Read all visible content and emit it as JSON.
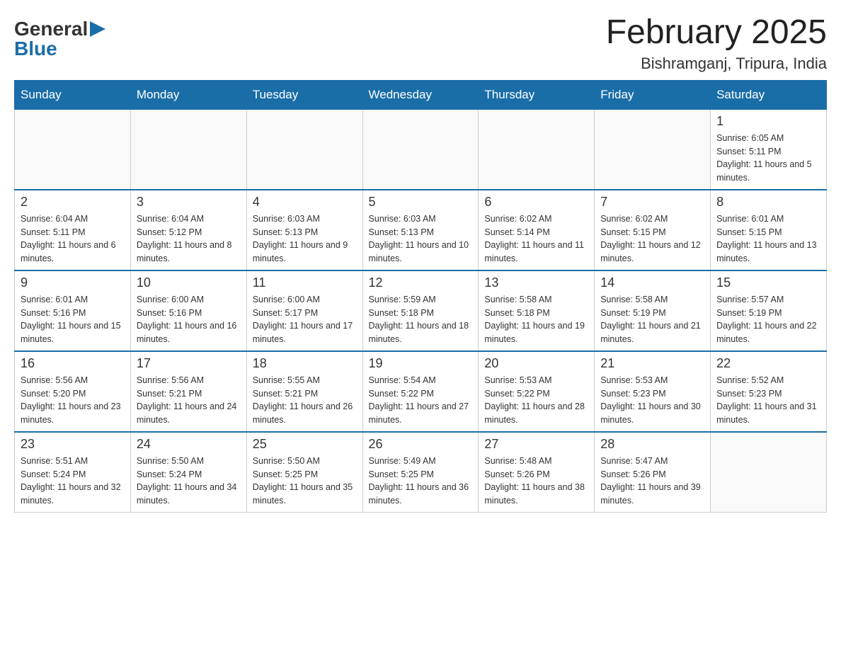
{
  "header": {
    "logo": {
      "general": "General",
      "arrow": "▶",
      "blue": "Blue"
    },
    "title": "February 2025",
    "location": "Bishramganj, Tripura, India"
  },
  "weekdays": [
    "Sunday",
    "Monday",
    "Tuesday",
    "Wednesday",
    "Thursday",
    "Friday",
    "Saturday"
  ],
  "weeks": [
    [
      {
        "day": "",
        "info": ""
      },
      {
        "day": "",
        "info": ""
      },
      {
        "day": "",
        "info": ""
      },
      {
        "day": "",
        "info": ""
      },
      {
        "day": "",
        "info": ""
      },
      {
        "day": "",
        "info": ""
      },
      {
        "day": "1",
        "info": "Sunrise: 6:05 AM\nSunset: 5:11 PM\nDaylight: 11 hours and 5 minutes."
      }
    ],
    [
      {
        "day": "2",
        "info": "Sunrise: 6:04 AM\nSunset: 5:11 PM\nDaylight: 11 hours and 6 minutes."
      },
      {
        "day": "3",
        "info": "Sunrise: 6:04 AM\nSunset: 5:12 PM\nDaylight: 11 hours and 8 minutes."
      },
      {
        "day": "4",
        "info": "Sunrise: 6:03 AM\nSunset: 5:13 PM\nDaylight: 11 hours and 9 minutes."
      },
      {
        "day": "5",
        "info": "Sunrise: 6:03 AM\nSunset: 5:13 PM\nDaylight: 11 hours and 10 minutes."
      },
      {
        "day": "6",
        "info": "Sunrise: 6:02 AM\nSunset: 5:14 PM\nDaylight: 11 hours and 11 minutes."
      },
      {
        "day": "7",
        "info": "Sunrise: 6:02 AM\nSunset: 5:15 PM\nDaylight: 11 hours and 12 minutes."
      },
      {
        "day": "8",
        "info": "Sunrise: 6:01 AM\nSunset: 5:15 PM\nDaylight: 11 hours and 13 minutes."
      }
    ],
    [
      {
        "day": "9",
        "info": "Sunrise: 6:01 AM\nSunset: 5:16 PM\nDaylight: 11 hours and 15 minutes."
      },
      {
        "day": "10",
        "info": "Sunrise: 6:00 AM\nSunset: 5:16 PM\nDaylight: 11 hours and 16 minutes."
      },
      {
        "day": "11",
        "info": "Sunrise: 6:00 AM\nSunset: 5:17 PM\nDaylight: 11 hours and 17 minutes."
      },
      {
        "day": "12",
        "info": "Sunrise: 5:59 AM\nSunset: 5:18 PM\nDaylight: 11 hours and 18 minutes."
      },
      {
        "day": "13",
        "info": "Sunrise: 5:58 AM\nSunset: 5:18 PM\nDaylight: 11 hours and 19 minutes."
      },
      {
        "day": "14",
        "info": "Sunrise: 5:58 AM\nSunset: 5:19 PM\nDaylight: 11 hours and 21 minutes."
      },
      {
        "day": "15",
        "info": "Sunrise: 5:57 AM\nSunset: 5:19 PM\nDaylight: 11 hours and 22 minutes."
      }
    ],
    [
      {
        "day": "16",
        "info": "Sunrise: 5:56 AM\nSunset: 5:20 PM\nDaylight: 11 hours and 23 minutes."
      },
      {
        "day": "17",
        "info": "Sunrise: 5:56 AM\nSunset: 5:21 PM\nDaylight: 11 hours and 24 minutes."
      },
      {
        "day": "18",
        "info": "Sunrise: 5:55 AM\nSunset: 5:21 PM\nDaylight: 11 hours and 26 minutes."
      },
      {
        "day": "19",
        "info": "Sunrise: 5:54 AM\nSunset: 5:22 PM\nDaylight: 11 hours and 27 minutes."
      },
      {
        "day": "20",
        "info": "Sunrise: 5:53 AM\nSunset: 5:22 PM\nDaylight: 11 hours and 28 minutes."
      },
      {
        "day": "21",
        "info": "Sunrise: 5:53 AM\nSunset: 5:23 PM\nDaylight: 11 hours and 30 minutes."
      },
      {
        "day": "22",
        "info": "Sunrise: 5:52 AM\nSunset: 5:23 PM\nDaylight: 11 hours and 31 minutes."
      }
    ],
    [
      {
        "day": "23",
        "info": "Sunrise: 5:51 AM\nSunset: 5:24 PM\nDaylight: 11 hours and 32 minutes."
      },
      {
        "day": "24",
        "info": "Sunrise: 5:50 AM\nSunset: 5:24 PM\nDaylight: 11 hours and 34 minutes."
      },
      {
        "day": "25",
        "info": "Sunrise: 5:50 AM\nSunset: 5:25 PM\nDaylight: 11 hours and 35 minutes."
      },
      {
        "day": "26",
        "info": "Sunrise: 5:49 AM\nSunset: 5:25 PM\nDaylight: 11 hours and 36 minutes."
      },
      {
        "day": "27",
        "info": "Sunrise: 5:48 AM\nSunset: 5:26 PM\nDaylight: 11 hours and 38 minutes."
      },
      {
        "day": "28",
        "info": "Sunrise: 5:47 AM\nSunset: 5:26 PM\nDaylight: 11 hours and 39 minutes."
      },
      {
        "day": "",
        "info": ""
      }
    ]
  ]
}
